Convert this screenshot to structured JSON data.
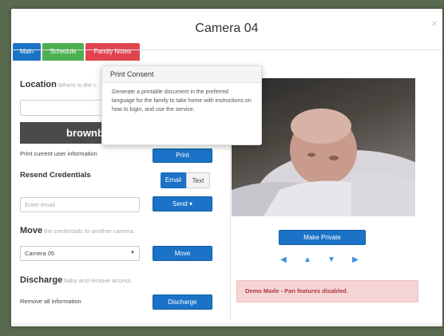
{
  "modal": {
    "title": "Camera 04",
    "close_glyph": "×"
  },
  "tabs": [
    {
      "label": "Main",
      "color": "#1a73c7"
    },
    {
      "label": "Schedule",
      "color": "#4caf50"
    },
    {
      "label": "Family Notes",
      "color": "#e0454f"
    }
  ],
  "tooltip": {
    "title": "Print Consent",
    "body": "Generate a printable document in the preferred language for the family to take home with instructions on how to login, and use the service."
  },
  "location": {
    "heading": "Location",
    "subtext": "Where is the c",
    "banner_text": "brownb"
  },
  "print_info": {
    "label": "Print current user information",
    "button": "Print"
  },
  "resend": {
    "heading": "Resend Credentials",
    "toggle_email": "Email",
    "toggle_text": "Text",
    "email_placeholder": "Enter email",
    "send_button": "Send ▾"
  },
  "move": {
    "heading": "Move",
    "subtext": "the credentials to another camera.",
    "selected_camera": "Camera 05",
    "button": "Move"
  },
  "discharge": {
    "heading": "Discharge",
    "subtext": "baby and remove access.",
    "label": "Remove all information",
    "button": "Discharge"
  },
  "camera_panel": {
    "make_private": "Make Private",
    "pan_icons": [
      "arrow-left-icon",
      "arrow-up-icon",
      "arrow-down-icon",
      "arrow-right-icon"
    ],
    "demo_alert": "Demo Mode - Pan features disabled."
  },
  "colors": {
    "primary": "#1a73c7",
    "danger_text": "#b13a3f",
    "alert_bg": "#f5d4d5"
  }
}
